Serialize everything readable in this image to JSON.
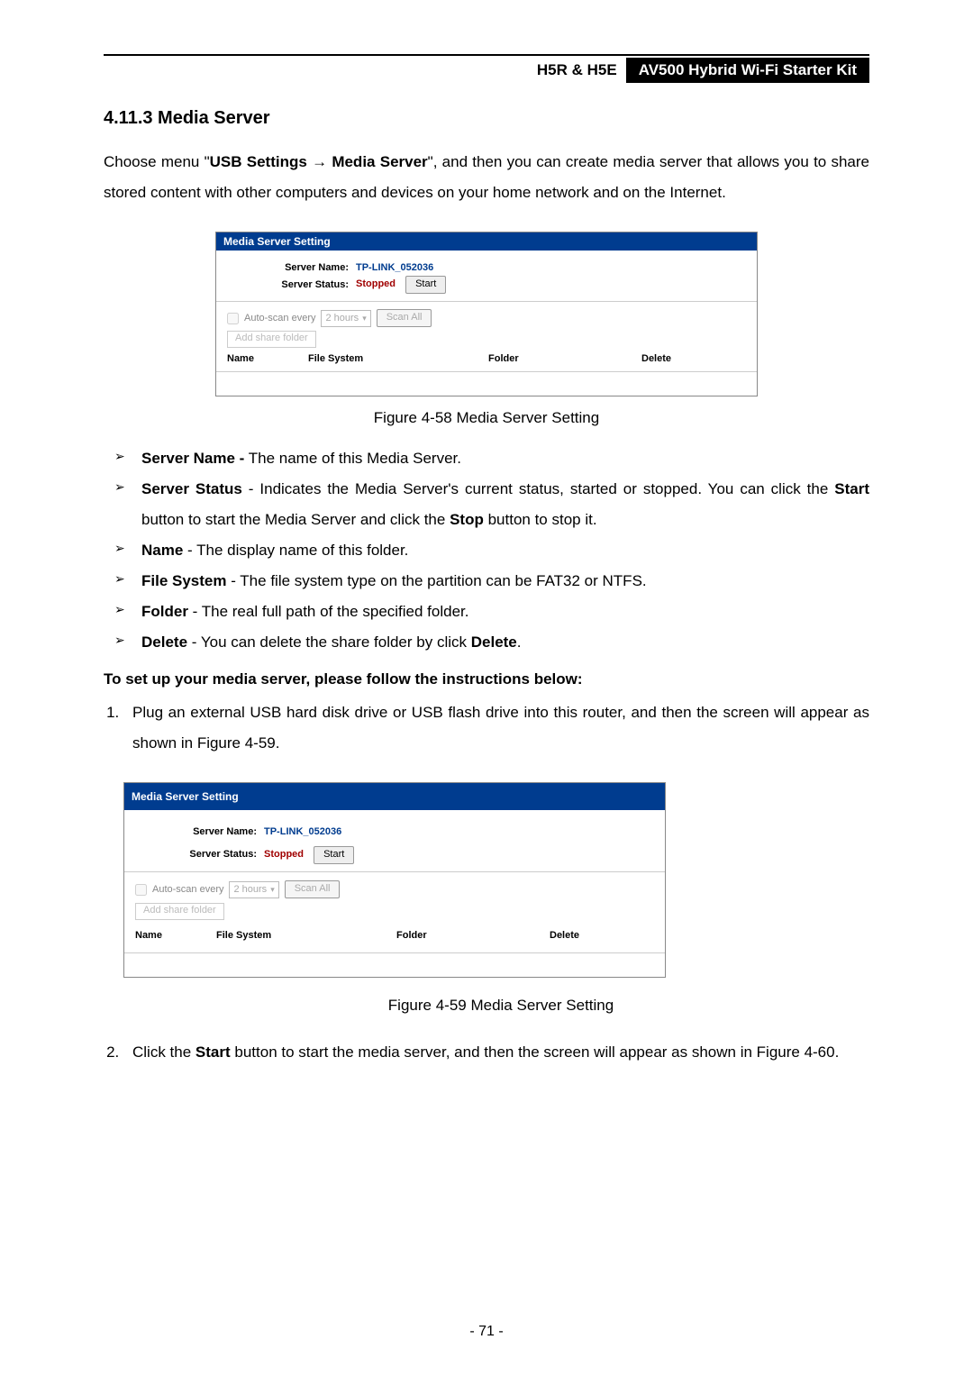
{
  "header": {
    "left": "H5R & H5E",
    "right": "AV500 Hybrid Wi-Fi Starter Kit"
  },
  "section_title": "4.11.3  Media Server",
  "intro": {
    "pre": "Choose menu \"",
    "menu1": "USB Settings",
    "arrow": " → ",
    "menu2": "Media Server",
    "post": "\", and then you can create media server that allows you to share stored content with other computers and devices on your home network and on the Internet."
  },
  "panel": {
    "title": "Media Server Setting",
    "server_name_label": "Server Name:",
    "server_name_value": "TP-LINK_052036",
    "server_status_label": "Server Status:",
    "server_status_value": "Stopped",
    "start_btn": "Start",
    "autoscan_label": "Auto-scan every",
    "autoscan_select": "2 hours",
    "scan_all": "Scan All",
    "add_share": "Add share folder",
    "cols": {
      "name": "Name",
      "fs": "File System",
      "folder": "Folder",
      "delete": "Delete"
    }
  },
  "fig58": "Figure 4-58 Media Server Setting",
  "bullets": [
    {
      "b": "Server Name -",
      "t": " The name of this Media Server."
    },
    {
      "b": "Server Status",
      "t": " - Indicates the Media Server's current status, started or stopped. You can click the ",
      "b2": "Start",
      "t2": " button to start the Media Server and click the ",
      "b3": "Stop",
      "t3": " button to stop it."
    },
    {
      "b": "Name",
      "t": " - The display name of this folder."
    },
    {
      "b": "File System",
      "t": " - The file system type on the partition can be FAT32 or NTFS."
    },
    {
      "b": "Folder",
      "t": " - The real full path of the specified folder."
    },
    {
      "b": "Delete",
      "t": " - You can delete the share folder by click ",
      "b2": "Delete",
      "t2": "."
    }
  ],
  "instructions_heading": "To set up your media server, please follow the instructions below:",
  "step1": {
    "pre": "Plug an external USB hard disk drive or USB flash drive into this router, and then the screen will appear as shown in Figure 4-59."
  },
  "fig59": "Figure 4-59 Media Server Setting",
  "step2": {
    "pre": "Click the ",
    "b": "Start",
    "post": " button to start the media server, and then the screen will appear as shown in Figure 4-60."
  },
  "page_number": "- 71 -"
}
